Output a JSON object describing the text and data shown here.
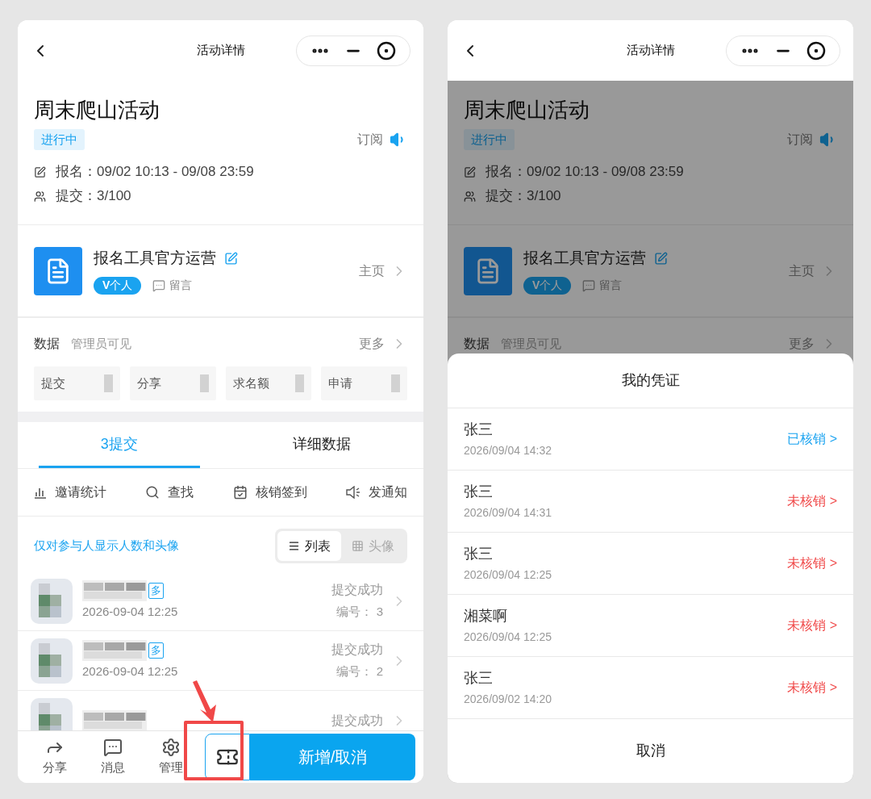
{
  "left_screen": {
    "nav": {
      "title": "活动详情"
    },
    "activity": {
      "title": "周末爬山活动",
      "status": "进行中",
      "subscribe": "订阅",
      "signup": "报名：09/02 10:13 - 09/08 23:59",
      "submitted": "提交：3/100"
    },
    "organizer": {
      "name": "报名工具官方运营",
      "badge": "**V**个人",
      "message": "留言",
      "home": "主页"
    },
    "data_section": {
      "title": "数据",
      "note": "管理员可见",
      "more": "更多",
      "stats": [
        "提交",
        "分享",
        "求名额",
        "申请"
      ]
    },
    "tabs": [
      {
        "label": "3提交",
        "selected": true
      },
      {
        "label": "详细数据",
        "selected": false
      }
    ],
    "tools": [
      {
        "kind": "chart",
        "label": "邀请统计"
      },
      {
        "kind": "search",
        "label": "查找"
      },
      {
        "kind": "checkin",
        "label": "核销签到"
      },
      {
        "kind": "notify",
        "label": "发通知"
      }
    ],
    "tip": "仅对参与人显示人数和头像",
    "view_toggle": [
      {
        "kind": "list",
        "label": "列表",
        "selected": true
      },
      {
        "kind": "grid",
        "label": "头像",
        "selected": false
      }
    ],
    "entries": [
      {
        "tag": "多",
        "time": "2026-09-04 12:25",
        "status": "提交成功",
        "number": "编号： 3"
      },
      {
        "tag": "多",
        "time": "2026-09-04 12:25",
        "status": "提交成功",
        "number": "编号： 2"
      },
      {
        "status": "提交成功"
      }
    ],
    "bottom_bar": {
      "items": [
        {
          "kind": "share",
          "label": "分享"
        },
        {
          "kind": "message",
          "label": "消息"
        },
        {
          "kind": "settings",
          "label": "管理"
        }
      ],
      "primary": "新增/取消"
    }
  },
  "right_screen": {
    "nav": {
      "title": "活动详情"
    },
    "activity": {
      "title": "周末爬山活动",
      "status": "进行中",
      "subscribe": "订阅",
      "signup": "报名：09/02 10:13 - 09/08 23:59",
      "submitted": "提交：3/100"
    },
    "organizer": {
      "name": "报名工具官方运营",
      "badge": "**V**个人",
      "message": "留言",
      "home": "主页"
    },
    "data_section": {
      "title": "数据",
      "note": "管理员可见",
      "more": "更多"
    },
    "sheet": {
      "title": "我的凭证",
      "cancel": "取消",
      "vouchers": [
        {
          "name": "张三",
          "time": "2026/09/04 14:32",
          "status": "已核销 >",
          "verified": true
        },
        {
          "name": "张三",
          "time": "2026/09/04 14:31",
          "status": "未核销 >",
          "verified": false
        },
        {
          "name": "张三",
          "time": "2026/09/04 12:25",
          "status": "未核销 >",
          "verified": false
        },
        {
          "name": "湘菜啊",
          "time": "2026/09/04 12:25",
          "status": "未核销 >",
          "verified": false
        },
        {
          "name": "张三",
          "time": "2026/09/02 14:20",
          "status": "未核销 >",
          "verified": false
        }
      ]
    }
  }
}
